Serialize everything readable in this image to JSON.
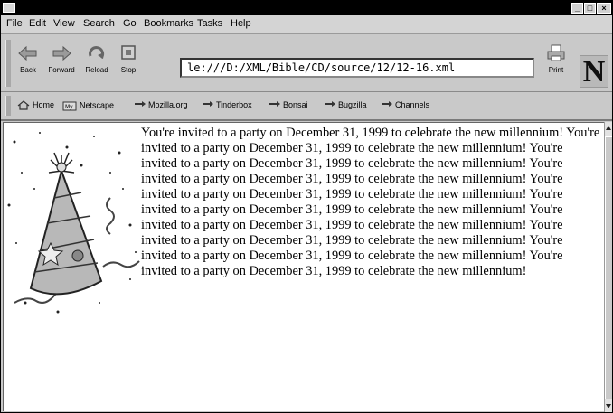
{
  "window": {
    "title": "",
    "controls": {
      "minimize_icon": "minimize-icon",
      "maximize_icon": "maximize-icon",
      "close_icon": "close-icon"
    }
  },
  "menu": {
    "items": [
      "File",
      "Edit",
      "View",
      "Search",
      "Go",
      "Bookmarks",
      "Tasks",
      "Help"
    ]
  },
  "toolbar": {
    "back_label": "Back",
    "forward_label": "Forward",
    "reload_label": "Reload",
    "stop_label": "Stop",
    "print_label": "Print",
    "url": "le:///D:/XML/Bible/CD/source/12/12-16.xml",
    "logo_text": "N"
  },
  "personal_toolbar": {
    "items": [
      "Home",
      "Netscape",
      "Mozilla.org",
      "Tinderbox",
      "Bonsai",
      "Bugzilla",
      "Channels"
    ]
  },
  "content": {
    "paragraph": "You're invited to a party on December 31, 1999 to celebrate the new millennium! You're invited to a party on December 31, 1999 to celebrate the new millennium! You're invited to a party on December 31, 1999 to celebrate the new millennium! You're invited to a party on December 31, 1999 to celebrate the new millennium! You're invited to a party on December 31, 1999 to celebrate the new millennium! You're invited to a party on December 31, 1999 to celebrate the new millennium! You're invited to a party on December 31, 1999 to celebrate the new millennium! You're invited to a party on December 31, 1999 to celebrate the new millennium! You're invited to a party on December 31, 1999 to celebrate the new millennium! You're invited to a party on December 31, 1999 to celebrate the new millennium!",
    "image": "party-hat-image"
  },
  "colors": {
    "chrome": "#c9c9c9",
    "titlebar": "#000000",
    "page_bg": "#ffffff"
  }
}
